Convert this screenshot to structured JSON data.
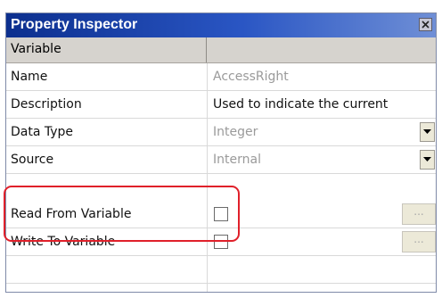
{
  "title": "Property Inspector",
  "close_icon": "close-icon",
  "column_header": "Variable",
  "rows": [
    {
      "label": "Name",
      "value": "AccessRight",
      "type": "text-dim"
    },
    {
      "label": "Description",
      "value": "Used to indicate the current",
      "type": "text"
    },
    {
      "label": "Data Type",
      "value": "Integer",
      "type": "dropdown"
    },
    {
      "label": "Source",
      "value": "Internal",
      "type": "dropdown"
    },
    {
      "label": "Read From Variable",
      "value": "",
      "type": "checkbox",
      "ellipsis": "..."
    },
    {
      "label": "Write To Variable",
      "value": "",
      "type": "checkbox",
      "ellipsis": "..."
    }
  ],
  "colors": {
    "titlebar_start": "#0c2f8e",
    "titlebar_end": "#6f8fd6",
    "highlight": "#e0202a"
  }
}
